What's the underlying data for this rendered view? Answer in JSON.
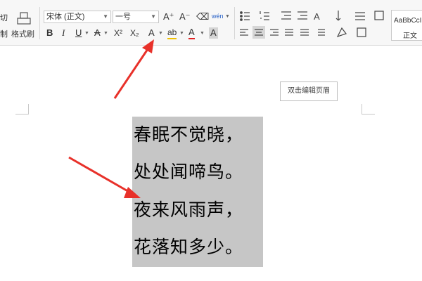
{
  "ribbon": {
    "clipboard": {
      "cut_partial": "切",
      "cut_partial2": "制",
      "format_painter": "格式刷"
    },
    "font": {
      "font_name": "宋体 (正文)",
      "font_size": "一号",
      "grow_label": "A⁺",
      "shrink_label": "A⁻",
      "clear_label": "⌫",
      "pinyin_label": "wén",
      "bold": "B",
      "italic": "I",
      "underline": "U",
      "strike": "A",
      "superscript": "X²",
      "subscript": "X₂",
      "text_effect": "A",
      "highlight": "ab",
      "font_color": "A",
      "char_shading": "A"
    },
    "styles": {
      "preview": "AaBbCcI",
      "normal": "正文"
    }
  },
  "document": {
    "header_tooltip": "双击编辑页眉",
    "poem": [
      "春眠不觉晓，",
      "处处闻啼鸟。",
      "夜来风雨声，",
      "花落知多少。"
    ]
  },
  "colors": {
    "selection": "#c6c6c6",
    "arrow": "#e8312a",
    "font_color_bar": "#e02020",
    "highlight_bar": "#f0c000"
  }
}
